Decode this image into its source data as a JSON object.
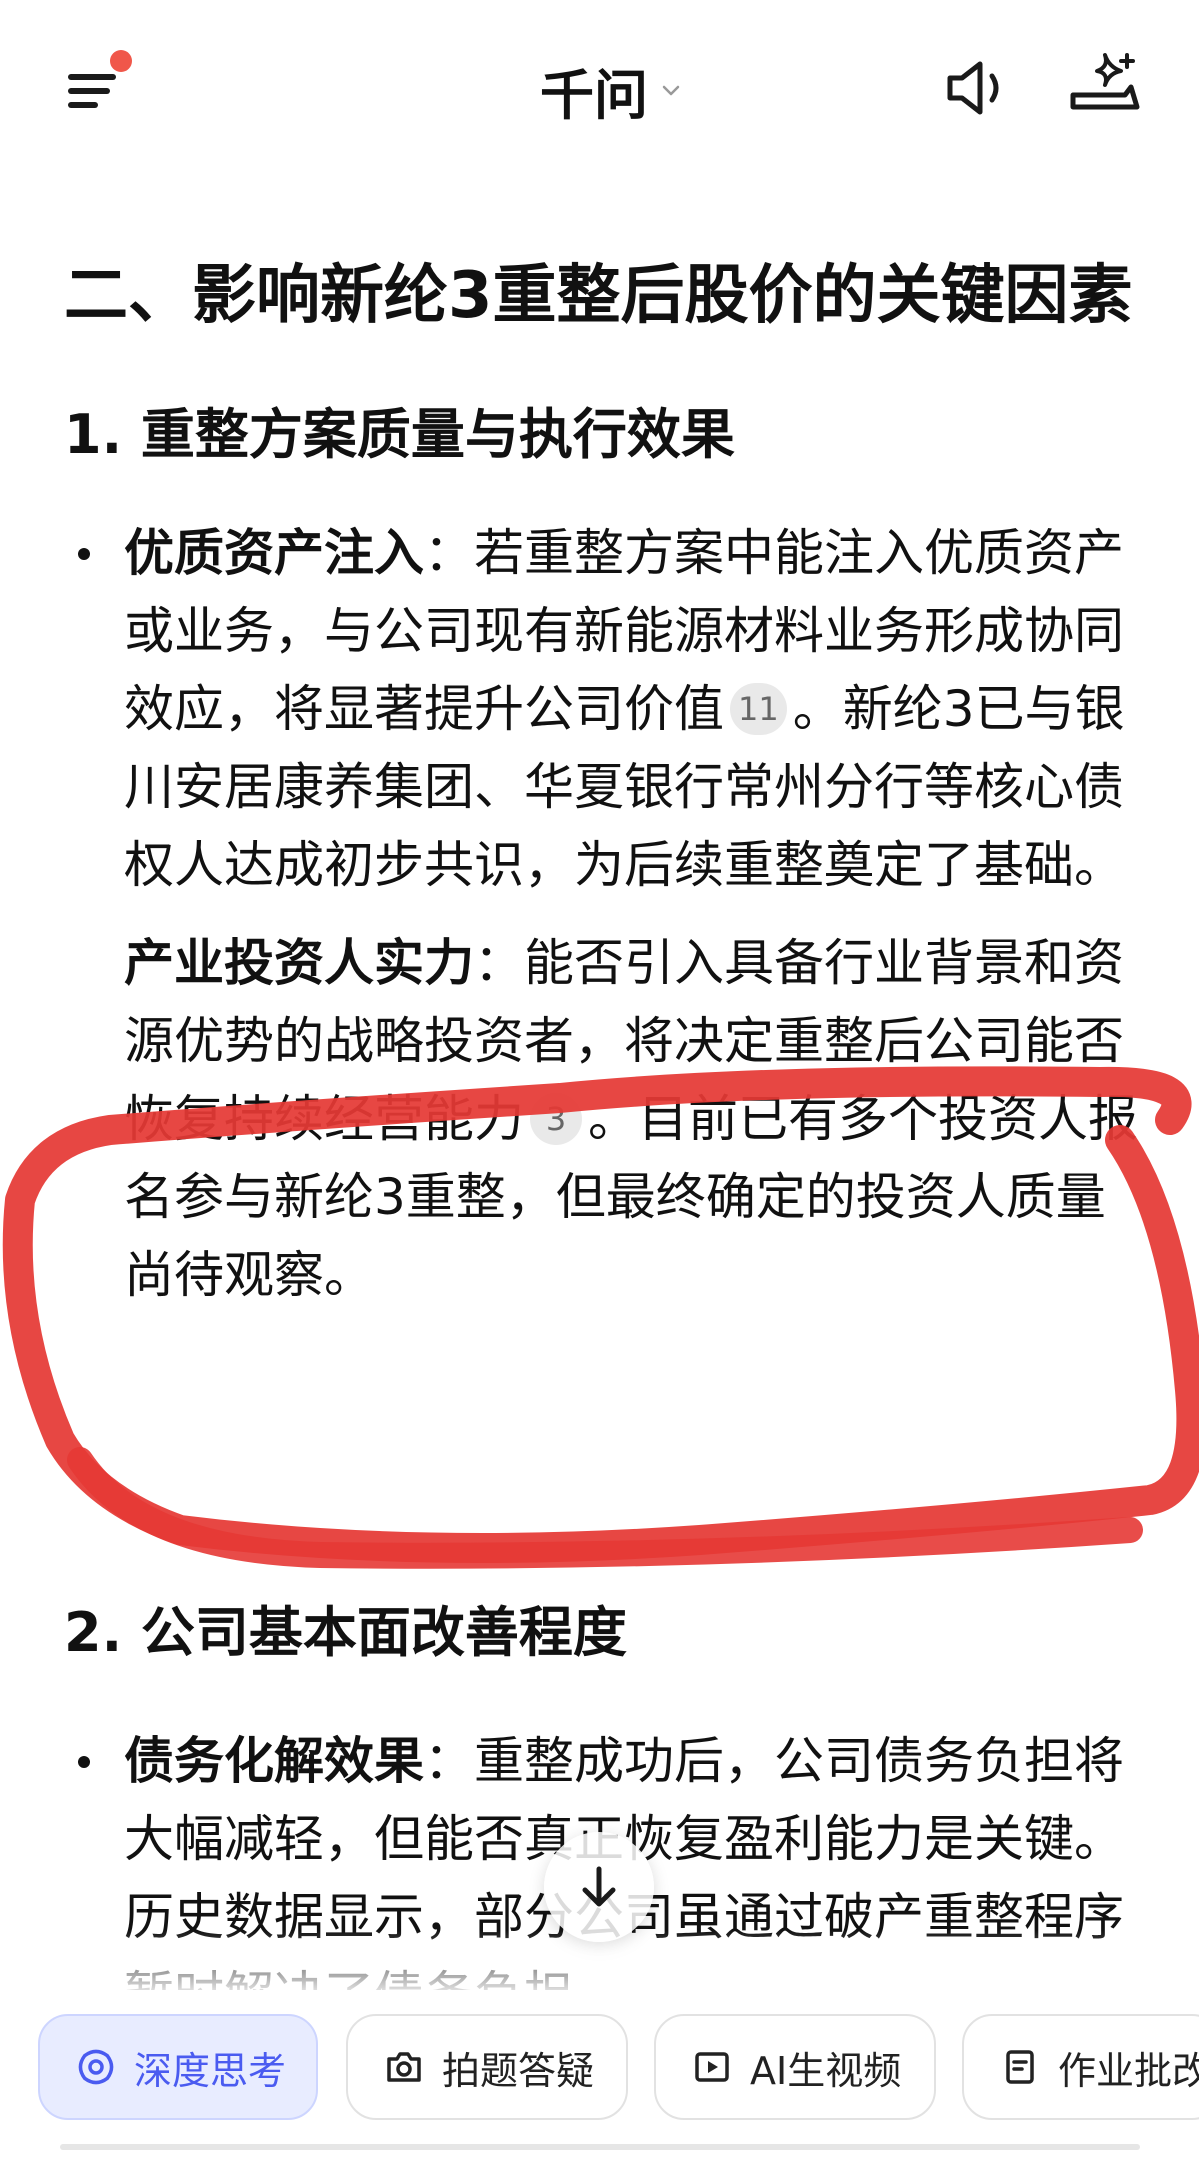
{
  "header": {
    "title": "千问"
  },
  "content": {
    "heading": "二、影响新纶3重整后股价的关键因素",
    "section1": {
      "heading": "1. 重整方案质量与执行效果",
      "bullets": [
        {
          "label": "优质资产注入",
          "text_a": "：若重整方案中能注入优质资产或业务，与公司现有新能源材料业务形成协同效应，将显著提升公司价值",
          "cite": "11",
          "text_b": "。新纶3已与银川安居康养集团、华夏银行常州分行等核心债权人达成初步共识，为后续重整奠定了基础。"
        },
        {
          "label": "产业投资人实力",
          "text_a": "：能否引入具备行业背景和资源优势的战略投资者，将决定重整后公司能否恢复持续经营能力",
          "cite": "3",
          "text_b": "。目前已有多个投资人报名参与新纶3重整，但最终确定的投资人质量尚待观察。"
        }
      ]
    },
    "section2": {
      "heading": "2. 公司基本面改善程度",
      "bullets": [
        {
          "label": "债务化解效果",
          "text": "：重整成功后，公司债务负担将大幅减轻，但能否真正恢复盈利能力是关键。历史数据显示，部分公司虽通过破产重整程序暂时解决了债务负担"
        }
      ]
    }
  },
  "toolbar": {
    "chips": [
      {
        "label": "深度思考",
        "icon": "deep-think-icon",
        "active": true
      },
      {
        "label": "拍题答疑",
        "icon": "camera-icon",
        "active": false
      },
      {
        "label": "AI生视频",
        "icon": "video-icon",
        "active": false
      },
      {
        "label": "作业批改",
        "icon": "homework-icon",
        "active": false
      }
    ]
  },
  "colors": {
    "accent": "#4a5bf0",
    "annotation": "#e53935",
    "notification_dot": "#f0574a"
  }
}
